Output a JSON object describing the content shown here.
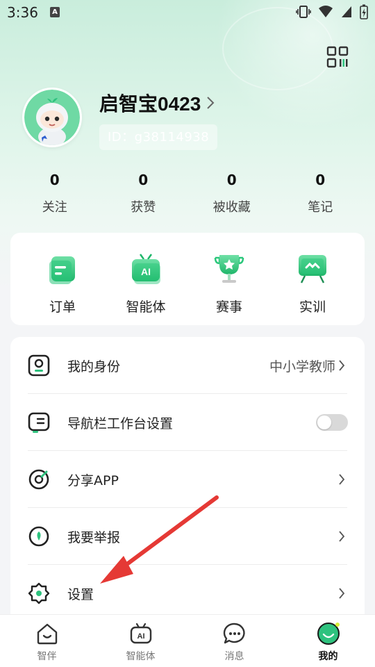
{
  "status_bar": {
    "time": "3:36",
    "notification_letter": "A"
  },
  "profile": {
    "username": "启智宝0423",
    "user_id": "ID：g38114938"
  },
  "stats": [
    {
      "value": "0",
      "label": "关注"
    },
    {
      "value": "0",
      "label": "获赞"
    },
    {
      "value": "0",
      "label": "被收藏"
    },
    {
      "value": "0",
      "label": "笔记"
    }
  ],
  "quick_actions": [
    {
      "label": "订单",
      "icon": "order-icon"
    },
    {
      "label": "智能体",
      "icon": "ai-agent-icon",
      "icon_text": "AI"
    },
    {
      "label": "赛事",
      "icon": "trophy-icon"
    },
    {
      "label": "实训",
      "icon": "training-board-icon"
    }
  ],
  "menu": {
    "identity": {
      "label": "我的身份",
      "value": "中小学教师"
    },
    "nav_settings": {
      "label": "导航栏工作台设置",
      "toggle_on": false
    },
    "share": {
      "label": "分享APP"
    },
    "report": {
      "label": "我要举报"
    },
    "settings": {
      "label": "设置"
    }
  },
  "tab_bar": {
    "tabs": [
      {
        "label": "智伴",
        "icon": "home-smile-icon",
        "active": false
      },
      {
        "label": "智能体",
        "icon": "ai-robot-icon",
        "icon_text": "AI",
        "active": false
      },
      {
        "label": "消息",
        "icon": "message-bubble-icon",
        "active": false
      },
      {
        "label": "我的",
        "icon": "profile-avatar-icon",
        "active": true
      }
    ]
  },
  "colors": {
    "accent_green": "#2ec27e",
    "annotation_red": "#e53935",
    "header_gradient_top": "#c9eddc"
  }
}
